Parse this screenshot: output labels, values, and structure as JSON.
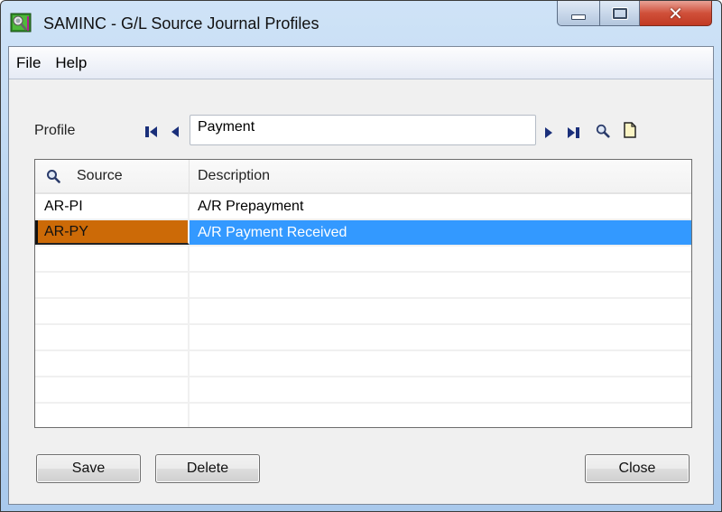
{
  "window": {
    "title": "SAMINC - G/L Source Journal Profiles",
    "app_icon": "profile-app-icon",
    "caption_buttons": {
      "minimize": "minimize-icon",
      "maximize": "maximize-icon",
      "close": "close-icon",
      "close_glyph": "✕"
    }
  },
  "menu": {
    "items": [
      {
        "label": "File"
      },
      {
        "label": "Help"
      }
    ]
  },
  "profile": {
    "label": "Profile",
    "value": "Payment",
    "nav_icons": [
      "first-record-icon",
      "previous-record-icon",
      "next-record-icon",
      "last-record-icon",
      "finder-icon",
      "new-document-icon"
    ]
  },
  "grid": {
    "columns": [
      {
        "label": "Source",
        "icon": "search-icon"
      },
      {
        "label": "Description"
      }
    ],
    "rows": [
      {
        "source": "AR-PI",
        "description": "A/R Prepayment",
        "selected": false
      },
      {
        "source": "AR-PY",
        "description": "A/R Payment Received",
        "selected": true
      },
      {
        "source": "",
        "description": "",
        "selected": false
      },
      {
        "source": "",
        "description": "",
        "selected": false
      },
      {
        "source": "",
        "description": "",
        "selected": false
      },
      {
        "source": "",
        "description": "",
        "selected": false
      },
      {
        "source": "",
        "description": "",
        "selected": false
      },
      {
        "source": "",
        "description": "",
        "selected": false
      },
      {
        "source": "",
        "description": "",
        "selected": false
      }
    ],
    "colors": {
      "selected_source_bg": "#cc6a07",
      "selected_row_bg": "#3399ff"
    }
  },
  "buttons": {
    "save": "Save",
    "delete": "Delete",
    "close": "Close"
  }
}
